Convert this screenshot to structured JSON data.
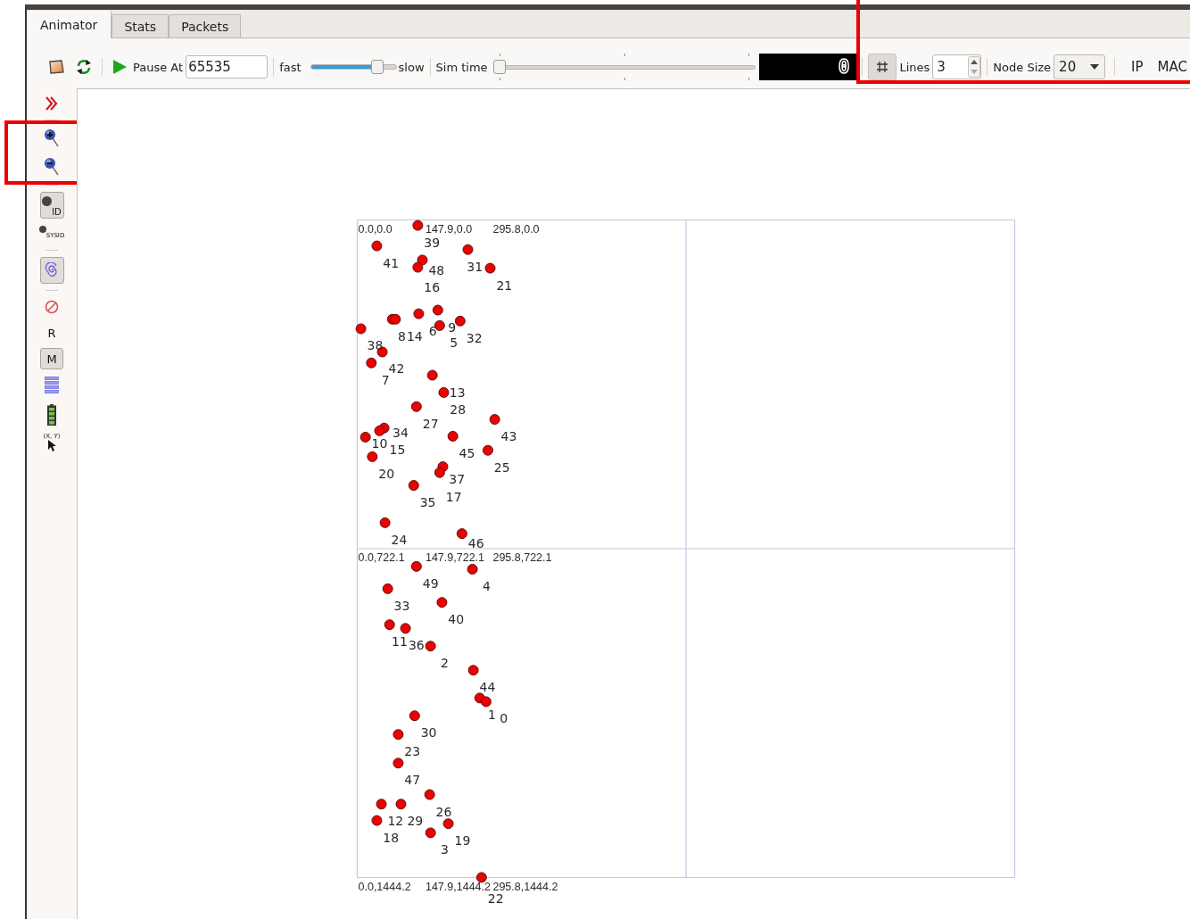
{
  "tabs": [
    {
      "label": "Animator",
      "selected": true
    },
    {
      "label": "Stats",
      "selected": false
    },
    {
      "label": "Packets",
      "selected": false
    }
  ],
  "toolbar": {
    "pause_label": "Pause At",
    "pause_value": "65535",
    "speed": {
      "fast_label": "fast",
      "slow_label": "slow",
      "level": 0.82
    },
    "sim_time": {
      "label": "Sim time",
      "level": 0
    },
    "time_display": "0",
    "grid": {
      "highlighted": true,
      "grid_on": true,
      "lines_label": "Lines",
      "lines_value": "3",
      "node_size_label": "Node Size",
      "node_size_value": "20",
      "ip_label": "IP",
      "mac_label": "MAC"
    }
  },
  "sidebar": {
    "groups": [
      {
        "highlighted": false,
        "items": [
          {
            "kind": "chevron"
          }
        ]
      },
      {
        "highlighted": true,
        "items": [
          {
            "kind": "zoom_in"
          },
          {
            "kind": "zoom_out"
          }
        ]
      },
      {
        "highlighted": false,
        "items": [
          {
            "kind": "node_id",
            "label": "ID",
            "checked": true
          },
          {
            "kind": "sys_id",
            "label": "SYSID",
            "checked": false
          }
        ]
      },
      {
        "highlighted": false,
        "items": [
          {
            "kind": "trajectory",
            "checked": true
          }
        ]
      },
      {
        "highlighted": false,
        "items": [
          {
            "kind": "block"
          },
          {
            "kind": "text",
            "label": "R",
            "checked": false
          },
          {
            "kind": "text",
            "label": "M",
            "checked": true
          },
          {
            "kind": "lines"
          },
          {
            "kind": "battery"
          },
          {
            "kind": "cursor",
            "label": "(X, Y)"
          }
        ]
      }
    ]
  },
  "canvas": {
    "grid_labels": [
      "0.0,0.0",
      "147.9,0.0",
      "295.8,0.0",
      "0.0,722.1",
      "147.9,722.1",
      "295.8,722.1",
      "0.0,1444.2",
      "147.9,1444.2",
      "295.8,1444.2"
    ],
    "nodes": [
      {
        "label": "39"
      },
      {
        "label": "41"
      },
      {
        "label": "31"
      },
      {
        "label": "48"
      },
      {
        "label": "16"
      },
      {
        "label": "21"
      },
      {
        "label": "9"
      },
      {
        "label": "6"
      },
      {
        "label": "8"
      },
      {
        "label": "14"
      },
      {
        "label": "32"
      },
      {
        "label": "38"
      },
      {
        "label": "5"
      },
      {
        "label": "42"
      },
      {
        "label": "7"
      },
      {
        "label": "13"
      },
      {
        "label": "28"
      },
      {
        "label": "27"
      },
      {
        "label": "43"
      },
      {
        "label": "34"
      },
      {
        "label": "15"
      },
      {
        "label": "45"
      },
      {
        "label": "10"
      },
      {
        "label": "25"
      },
      {
        "label": "20"
      },
      {
        "label": "37"
      },
      {
        "label": "17"
      },
      {
        "label": "35"
      },
      {
        "label": "24"
      },
      {
        "label": "46"
      },
      {
        "label": "49"
      },
      {
        "label": "4"
      },
      {
        "label": "33"
      },
      {
        "label": "40"
      },
      {
        "label": "11"
      },
      {
        "label": "36"
      },
      {
        "label": "2"
      },
      {
        "label": "44"
      },
      {
        "label": "1"
      },
      {
        "label": "0"
      },
      {
        "label": "30"
      },
      {
        "label": "23"
      },
      {
        "label": "47"
      },
      {
        "label": "26"
      },
      {
        "label": "12"
      },
      {
        "label": "29"
      },
      {
        "label": "18"
      },
      {
        "label": "19"
      },
      {
        "label": "3"
      },
      {
        "label": "22"
      }
    ]
  }
}
